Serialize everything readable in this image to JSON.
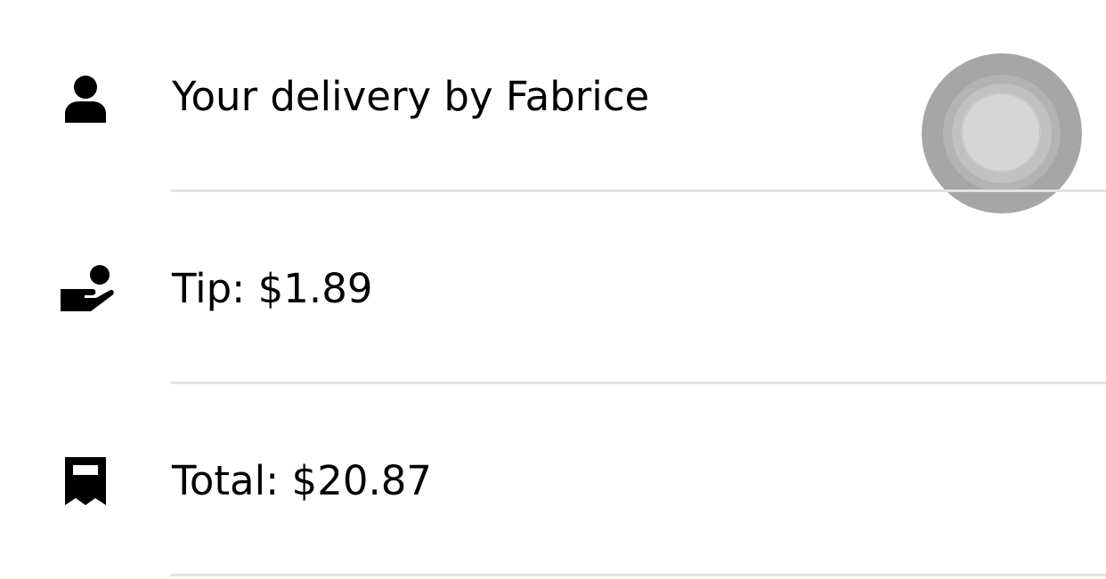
{
  "rows": [
    {
      "icon": "person-icon",
      "label": "Your delivery by Fabrice"
    },
    {
      "icon": "tip-hand-icon",
      "label": "Tip: $1.89"
    },
    {
      "icon": "receipt-icon",
      "label": "Total: $20.87"
    }
  ],
  "colors": {
    "text": "#000000",
    "divider": "#e3e3e3",
    "avatar": "#a6a6a6"
  }
}
